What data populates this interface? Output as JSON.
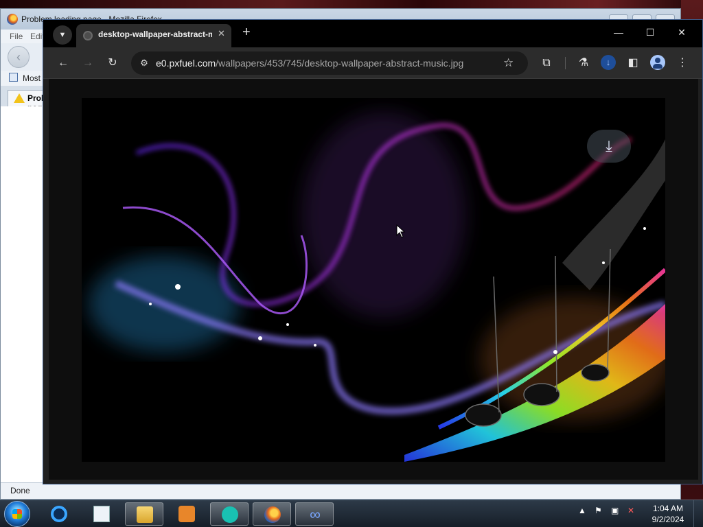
{
  "firefox": {
    "title": "Problem loading page - Mozilla Firefox",
    "menu": [
      "File",
      "Edit"
    ],
    "bookmark": "Most Visited",
    "tab_label": "Problem loading page",
    "status": "Done"
  },
  "chrome": {
    "tab_title": "desktop-wallpaper-abstract-music.jpg",
    "url_host": "e0.pxfuel.com",
    "url_path": "/wallpapers/453/745/desktop-wallpaper-abstract-music.jpg"
  },
  "icons": {
    "tab_search": "chevron-down-icon",
    "new_tab": "plus-icon",
    "minimize": "minimize-icon",
    "maximize": "maximize-icon",
    "close": "close-icon",
    "back": "back-arrow-icon",
    "forward": "forward-arrow-icon",
    "reload": "reload-icon",
    "site_info": "tune-icon",
    "bookmark": "star-icon",
    "extensions": "puzzle-icon",
    "labs": "flask-icon",
    "downloads": "download-icon",
    "side_panel": "side-panel-icon",
    "profile": "profile-icon",
    "menu": "kebab-menu-icon",
    "image_download": "download-icon"
  },
  "taskbar": {
    "apps": [
      "internet-explorer",
      "notepad",
      "file-explorer",
      "media-player",
      "messenger",
      "firefox",
      "infinity-app"
    ],
    "time": "1:04 AM",
    "date": "9/2/2024"
  },
  "colors": {
    "chrome_bg": "#1f1f1f",
    "chrome_toolbar": "#2c2c2c",
    "accent_blue": "#a8c7fa"
  }
}
